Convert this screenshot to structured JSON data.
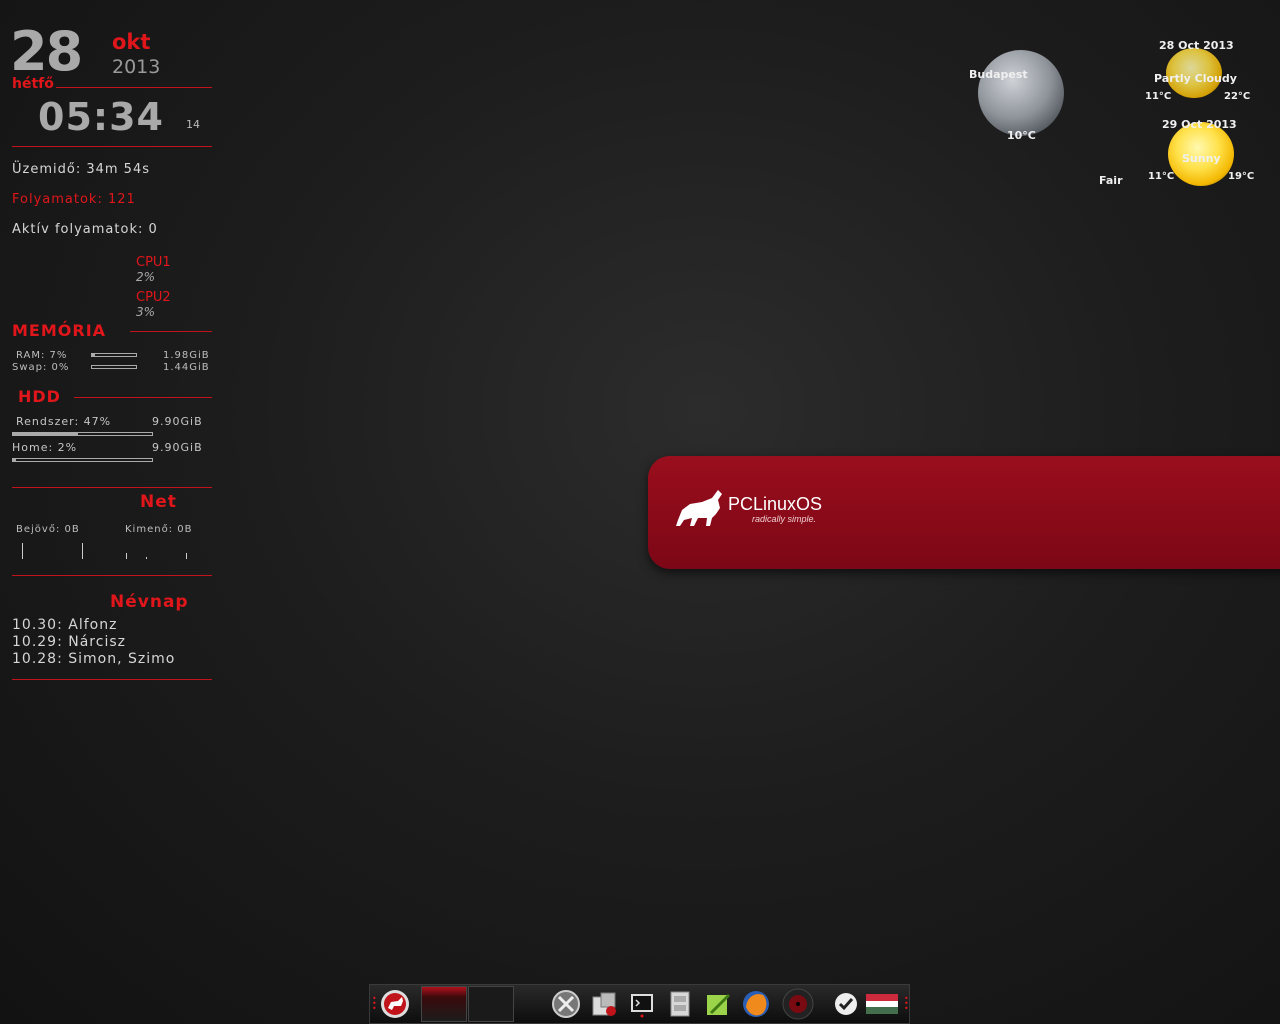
{
  "clock": {
    "day": "28",
    "month": "okt",
    "year": "2013",
    "weekday": "hétfő",
    "time": "05:34",
    "seconds": "14"
  },
  "system": {
    "uptime": "Üzemidő: 34m 54s",
    "processes": "Folyamatok: 121",
    "active_processes": "Aktív folyamatok: 0",
    "cpu1_label": "CPU1",
    "cpu1_value": "2%",
    "cpu2_label": "CPU2",
    "cpu2_value": "3%"
  },
  "memory": {
    "title": "MEMÓRIA",
    "ram_label": "RAM: 7%",
    "ram_total": "1.98GiB",
    "ram_fraction": 0.07,
    "swap_label": "Swap: 0%",
    "swap_total": "1.44GiB",
    "swap_fraction": 0.0
  },
  "hdd": {
    "title": "HDD",
    "system_label": "Rendszer: 47%",
    "system_total": "9.90GiB",
    "system_fraction": 0.47,
    "home_label": "Home: 2%",
    "home_total": "9.90GiB",
    "home_fraction": 0.02
  },
  "net": {
    "title": "Net",
    "in_label": "Bejövő: 0B",
    "out_label": "Kimenő: 0B"
  },
  "namedays": {
    "title": "Névnap",
    "items": [
      "10.30: Alfonz",
      "10.29: Nárcisz",
      "10.28: Simon, Szimo"
    ]
  },
  "weather": {
    "city": "Budapest",
    "current_temp": "10°C",
    "current_condition": "Fair",
    "day1": {
      "date": "28 Oct 2013",
      "condition": "Partly Cloudy",
      "low": "11°C",
      "high": "22°C"
    },
    "day2": {
      "date": "29 Oct 2013",
      "condition": "Sunny",
      "low": "11°C",
      "high": "19°C"
    }
  },
  "banner": {
    "logo": "PCLinuxOS",
    "tagline": "radically simple."
  },
  "dock": {
    "icons": [
      "pclinuxos-menu-icon",
      "desktop-pager-1",
      "desktop-pager-2",
      "system-settings-icon",
      "package-manager-icon",
      "terminal-icon",
      "file-manager-icon",
      "text-editor-icon",
      "firefox-icon",
      "media-player-icon",
      "update-check-icon",
      "hungarian-flag-icon"
    ]
  },
  "colors": {
    "accent": "#e0161b",
    "banner": "#8a0a19",
    "text_grey": "#a9a9a9"
  }
}
